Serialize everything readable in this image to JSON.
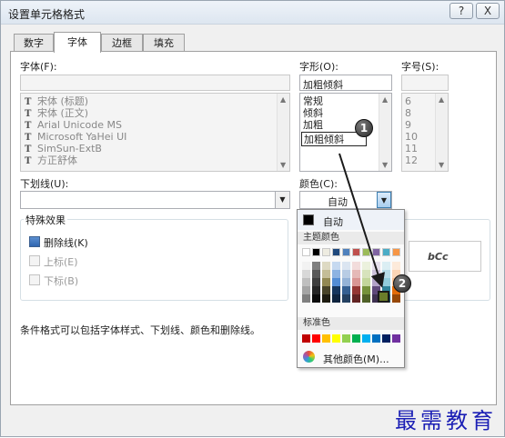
{
  "window": {
    "title": "设置单元格格式",
    "help": "?",
    "close": "X"
  },
  "tabs": [
    "数字",
    "字体",
    "边框",
    "填充"
  ],
  "font": {
    "label": "字体(F):",
    "value": "",
    "items": [
      "宋体 (标题)",
      "宋体 (正文)",
      "Arial Unicode MS",
      "Microsoft YaHei UI",
      "SimSun-ExtB",
      "方正舒体"
    ]
  },
  "style": {
    "label": "字形(O):",
    "value": "加粗倾斜",
    "items": [
      "常规",
      "倾斜",
      "加粗",
      "加粗倾斜"
    ],
    "selected": "加粗倾斜"
  },
  "size": {
    "label": "字号(S):",
    "value": "",
    "items": [
      "6",
      "8",
      "9",
      "10",
      "11",
      "12"
    ]
  },
  "underline": {
    "label": "下划线(U):",
    "value": ""
  },
  "color": {
    "label": "颜色(C):",
    "value": "自动"
  },
  "effects": {
    "title": "特殊效果",
    "strikethrough": "删除线(K)",
    "superscript": "上标(E)",
    "subscript": "下标(B)"
  },
  "preview": {
    "sample": "bCc"
  },
  "info_text": "条件格式可以包括字体样式、下划线、颜色和删除线。",
  "color_dropdown": {
    "auto_label": "自动",
    "theme_label": "主题颜色",
    "standard_label": "标准色",
    "more_label": "其他颜色(M)...",
    "theme_top": [
      "#ffffff",
      "#000000",
      "#eeece1",
      "#1f497d",
      "#4f81bd",
      "#c0504d",
      "#9bbb59",
      "#8064a2",
      "#4bacc6",
      "#f79646"
    ],
    "theme_shades": [
      [
        "#f2f2f2",
        "#7f7f7f",
        "#ddd9c3",
        "#c6d9f0",
        "#dbe5f1",
        "#f2dcdb",
        "#ebf1dd",
        "#e5e0ec",
        "#dbeef3",
        "#fdeada"
      ],
      [
        "#d8d8d8",
        "#595959",
        "#c4bd97",
        "#8db3e2",
        "#b8cce4",
        "#e5b9b7",
        "#d7e3bc",
        "#ccc1d9",
        "#b7dde8",
        "#fbd5b5"
      ],
      [
        "#bfbfbf",
        "#3f3f3f",
        "#938953",
        "#548dd4",
        "#95b3d7",
        "#d99694",
        "#c3d69b",
        "#b2a2c7",
        "#92cddc",
        "#fac08f"
      ],
      [
        "#a5a5a5",
        "#262626",
        "#494429",
        "#17365d",
        "#366092",
        "#953734",
        "#76923c",
        "#5f497a",
        "#31859b",
        "#e36c09"
      ],
      [
        "#7f7f7f",
        "#0c0c0c",
        "#1d1b10",
        "#0f243e",
        "#244061",
        "#632423",
        "#4f6128",
        "#3f3151",
        "#205867",
        "#974806"
      ]
    ],
    "standard": [
      "#c00000",
      "#ff0000",
      "#ffc000",
      "#ffff00",
      "#92d050",
      "#00b050",
      "#00b0f0",
      "#0070c0",
      "#002060",
      "#7030a0"
    ]
  },
  "callouts": [
    "1",
    "2"
  ],
  "watermark": "最需教育"
}
